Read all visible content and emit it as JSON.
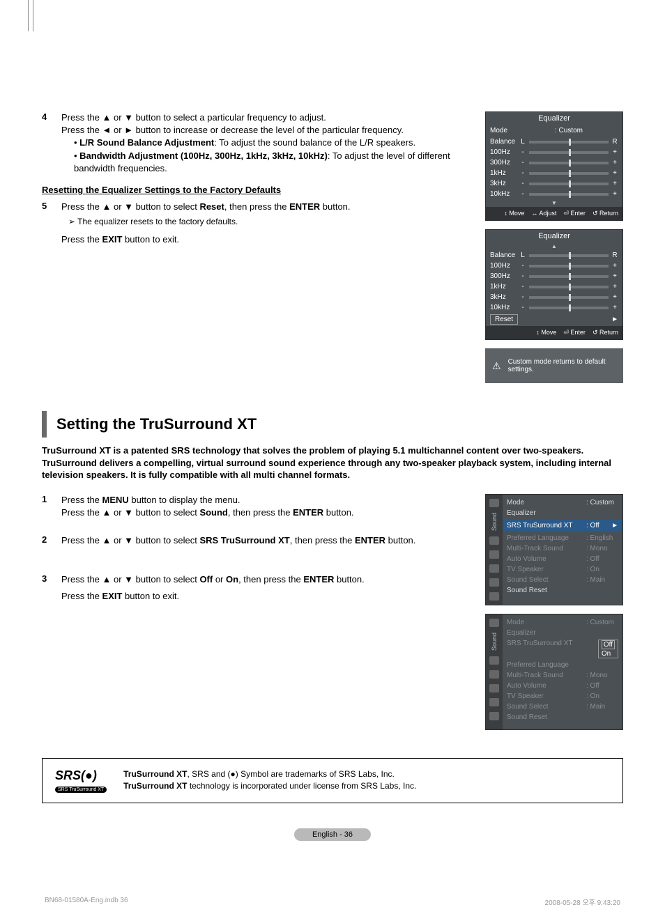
{
  "steps": {
    "s4": {
      "num": "4",
      "line1a": "Press the ▲ or ▼ button to select a particular frequency to adjust.",
      "line1b": "Press the ◄ or ► button to increase or decrease the level of the particular frequency.",
      "bullet1_b": "L/R Sound Balance Adjustment",
      "bullet1_t": ": To adjust the sound balance of the L/R speakers.",
      "bullet2_b": "Bandwidth Adjustment (100Hz, 300Hz, 1kHz, 3kHz, 10kHz)",
      "bullet2_t": ": To adjust the level of different bandwidth frequencies."
    },
    "s5": {
      "num": "5",
      "line1a": "Press the ▲ or ▼ button to select ",
      "line1b": "Reset",
      "line1c": ", then press the ",
      "line1d": "ENTER",
      "line1e": " button.",
      "note_prefix": "➢  ",
      "note": "The equalizer resets to the factory defaults.",
      "line2a": "Press the ",
      "line2b": "EXIT",
      "line2c": " button to exit."
    }
  },
  "heading_reset": "Resetting the Equalizer Settings to the Factory Defaults",
  "eq": {
    "title": "Equalizer",
    "mode_label": "Mode",
    "mode_value": ": Custom",
    "rows": [
      {
        "label": "Balance",
        "l": "L",
        "r": "R"
      },
      {
        "label": "100Hz",
        "l": "-",
        "r": "+"
      },
      {
        "label": "300Hz",
        "l": "-",
        "r": "+"
      },
      {
        "label": "1kHz",
        "l": "-",
        "r": "+"
      },
      {
        "label": "3kHz",
        "l": "-",
        "r": "+"
      },
      {
        "label": "10kHz",
        "l": "-",
        "r": "+"
      }
    ],
    "footer": {
      "move": "↕ Move",
      "adjust": "↔ Adjust",
      "enter": "⏎ Enter",
      "return": "↺ Return"
    },
    "reset": "Reset",
    "reset_arrow": "►"
  },
  "alert": "Custom mode returns to default settings.",
  "title_tsxt": "Setting the TruSurround XT",
  "intro_tsxt": "TruSurround XT is a patented SRS technology that solves the problem of playing 5.1 multichannel content over two-speakers. TruSurround delivers a compelling, virtual surround sound experience through any two-speaker playback system, including internal television speakers. It is fully compatible with all multi channel formats.",
  "tsxt": {
    "s1": {
      "num": "1",
      "a": "Press the ",
      "b": "MENU",
      "c": " button to display the menu.",
      "d": "Press the ▲ or ▼ button to select ",
      "e": "Sound",
      "f": ", then press the ",
      "g": "ENTER",
      "h": " button."
    },
    "s2": {
      "num": "2",
      "a": "Press the ▲ or ▼ button to select ",
      "b": "SRS TruSurround XT",
      "c": ", then press the ",
      "d": "ENTER",
      "e": " button."
    },
    "s3": {
      "num": "3",
      "a": "Press the ▲ or ▼ button to select ",
      "b": "Off",
      "c": " or ",
      "d": "On",
      "e": ", then press the ",
      "f": "ENTER",
      "g": " button.",
      "h": "Press the ",
      "i": "EXIT",
      "j": " button to exit."
    }
  },
  "menu": {
    "side": "Sound",
    "items": {
      "mode": {
        "l": "Mode",
        "v": ": Custom"
      },
      "eq": {
        "l": "Equalizer",
        "v": ""
      },
      "srs": {
        "l": "SRS TruSurround XT",
        "v": ": Off",
        "arrow": "►"
      },
      "lang": {
        "l": "Preferred Language",
        "v": ": English"
      },
      "mts": {
        "l": "Multi-Track Sound",
        "v": ": Mono"
      },
      "av": {
        "l": "Auto Volume",
        "v": ": Off"
      },
      "tvsp": {
        "l": "TV Speaker",
        "v": ": On"
      },
      "ss": {
        "l": "Sound Select",
        "v": ": Main"
      },
      "sr": {
        "l": "Sound Reset",
        "v": ""
      }
    },
    "popup": {
      "off": "Off",
      "on": "On"
    }
  },
  "srs_box": {
    "logo": "SRS(●)",
    "logo_sub": "SRS TruSurround XT",
    "line1a": "TruSurround XT",
    "line1b": ", SRS and (●) Symbol are trademarks of SRS Labs, Inc.",
    "line2a": "TruSurround XT",
    "line2b": " technology is incorporated under license from SRS Labs, Inc."
  },
  "page_pill": "English - 36",
  "print": {
    "left": "BN68-01580A-Eng.indb   36",
    "right": "2008-05-28   오후 9:43:20"
  }
}
